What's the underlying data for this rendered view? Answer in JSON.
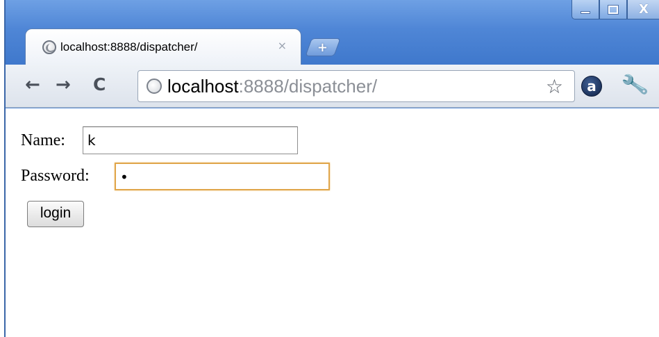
{
  "window": {
    "controls": {
      "minimize": "minimize",
      "maximize": "maximize",
      "close": "X"
    }
  },
  "tab": {
    "title": "localhost:8888/dispatcher/",
    "close": "×",
    "new_tab": "+"
  },
  "toolbar": {
    "back": "←",
    "forward": "→",
    "reload": "C",
    "url_host": "localhost",
    "url_rest": ":8888/dispatcher/",
    "star": "☆",
    "extension": "a",
    "wrench": "🔧"
  },
  "form": {
    "name_label": "Name:",
    "name_value": "k",
    "password_label": "Password:",
    "password_value": "•",
    "login_label": "login"
  },
  "icons": [
    "page-favicon-icon",
    "new-tab-icon",
    "back-arrow-icon",
    "forward-arrow-icon",
    "reload-icon",
    "star-icon",
    "extension-icon",
    "wrench-icon"
  ],
  "colors": {
    "frame": "#4f86d6",
    "focus_border": "#e0a64a"
  }
}
